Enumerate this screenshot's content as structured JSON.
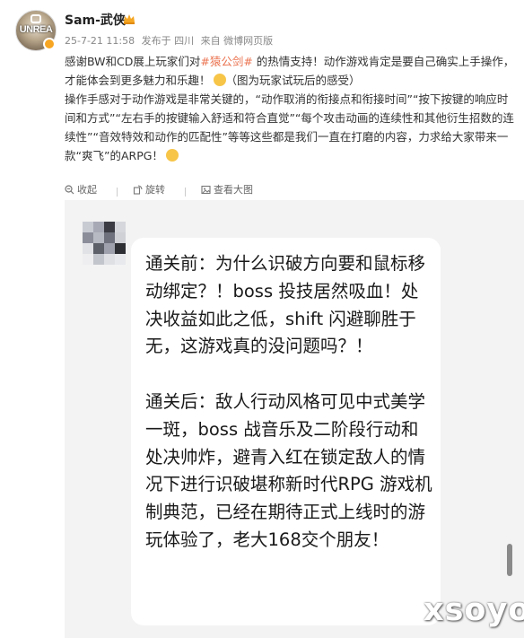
{
  "post": {
    "username": "Sam-武侠",
    "meta": {
      "date": "25-7-21 11:58",
      "location": "发布于 四川",
      "source": "来自 微博网页版"
    },
    "avatar_logo": "UNREA",
    "content": {
      "line1_pre": "感谢BW和CD展上玩家们对",
      "line1_topic": "#猿公剑#",
      "line1_post": " 的热情支持！动作游戏肯定是要自己确实上手操作，才能体会到更多魅力和乐趣！",
      "line1_note": "（图为玩家试玩后的感受）",
      "line2": "操作手感对于动作游戏是非常关键的，“动作取消的衔接点和衔接时间”“按下按键的响应时间和方式”“左右手的按键输入舒适和符合直觉”“每个攻击动画的连续性和其他衍生招数的连续性”“音效特效和动作的匹配性”等等这些都是我们一直在打磨的内容，力求给大家带来一款“爽飞”的ARPG！"
    },
    "actions": {
      "collapse": "收起",
      "rotate": "旋转",
      "view_large": "查看大图"
    }
  },
  "screenshot": {
    "text": "通关前：为什么识破方向要和鼠标移动绑定？！boss 投技居然吸血！处决收益如此之低，shift 闪避聊胜于无，这游戏真的没问题吗？！\n\n通关后：敌人行动风格可见中式美学一斑，boss 战音乐及二阶段行动和处决帅炸，避青入红在锁定敌人的情况下进行识破堪称新时代RPG 游戏机制典范，已经在期待正式上线时的游玩体验了，老大168交个朋友！"
  },
  "watermark": "xsoyo",
  "colors": {
    "topic": "#eb7350",
    "verified_badge": "#f7a623",
    "screenshot_bg": "#f3f3f3"
  },
  "icons": [
    "crown-icon",
    "verified-icon",
    "collapse-icon",
    "rotate-icon",
    "view-large-icon",
    "emoji-icon"
  ]
}
